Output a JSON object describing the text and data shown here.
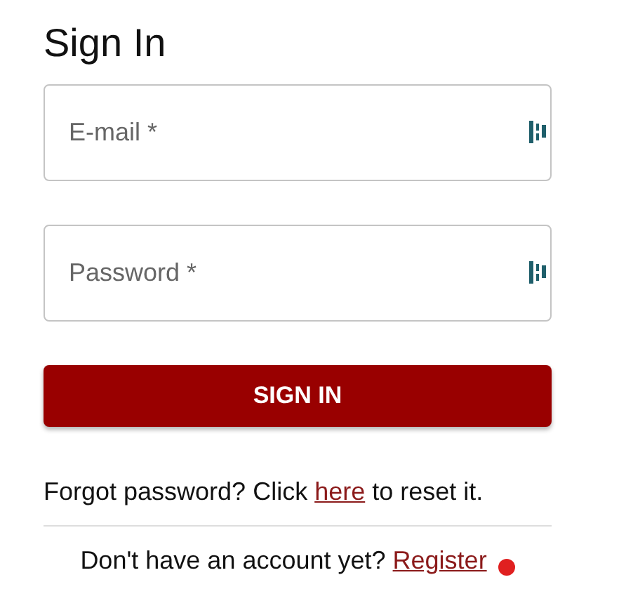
{
  "title": "Sign In",
  "fields": [
    {
      "placeholder": "E-mail *"
    },
    {
      "placeholder": "Password *"
    }
  ],
  "submit": "SIGN IN",
  "forgot": {
    "before": "Forgot password? Click ",
    "link": "here",
    "after": " to reset it."
  },
  "register": {
    "before": "Don't have an account yet? ",
    "link": "Register"
  }
}
